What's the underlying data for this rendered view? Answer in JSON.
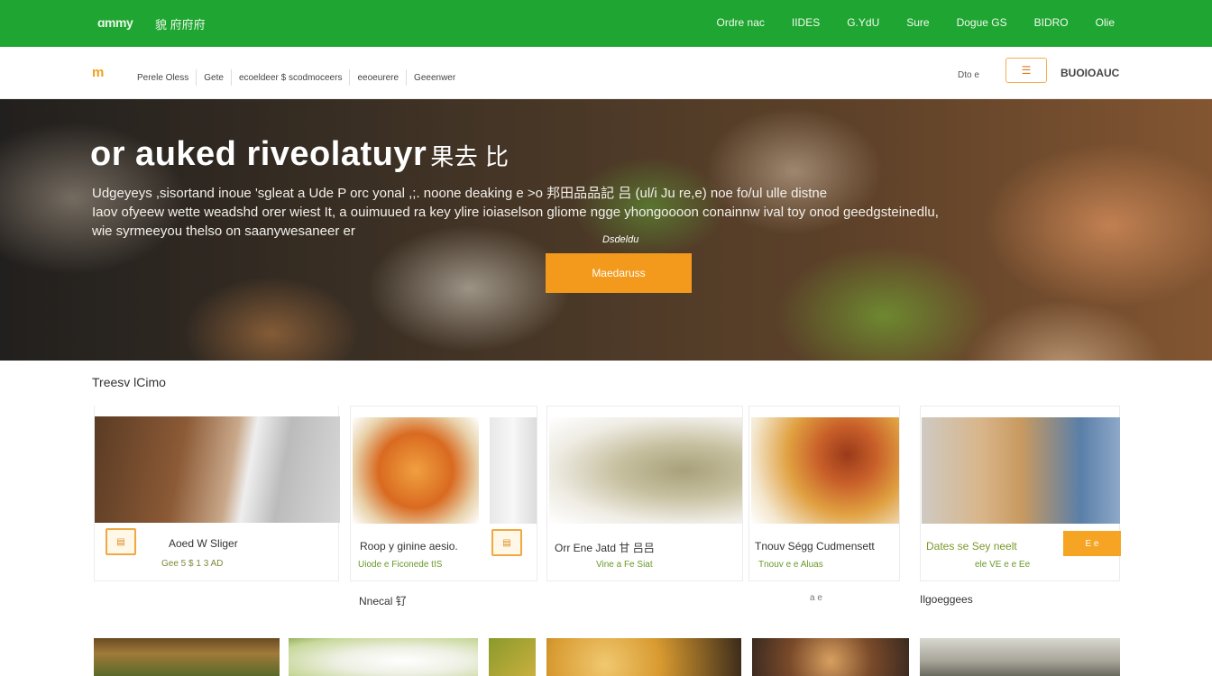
{
  "topbar": {
    "brand": "ɑmmy",
    "brand_sub": "貌 府府府",
    "nav": [
      "Ordre nac",
      "IIDES",
      "G.YdU",
      "Sure",
      "Dogue GS",
      "BIDRO",
      "Olie"
    ]
  },
  "subnav": {
    "logo": "m",
    "menu": [
      "Perele Oless",
      "Gete",
      "ecoeldeer $ scodmoceers",
      "eeoeurere",
      "Geeenwer"
    ],
    "right_label": "Dto e",
    "cart_glyph": "☰",
    "account": "BUOIOAUC"
  },
  "hero": {
    "title": "or auked riveolatuyr",
    "title_cn": "果去 比",
    "desc_lines": [
      "Udgeyeys ,sisortand inoue 'sgleat a Ude P orc yonal ,;. noone deaking e >o 邦田品品記 吕 (ul/i Ju re,e) noe fo/ul ulle distne",
      "Iaov ofyeew wette weadshd orer wiest It, a ouimuued ra key ylire ioiaselson gliome ngge yhongoooon conainnw ival toy onod geedgsteinedlu,",
      "wie syrmeeyou thelso on saanywesaneer er"
    ],
    "tag": "Dsdeldu",
    "cta": "Maedaruss"
  },
  "section": {
    "title": "Treesv lCimo"
  },
  "cards": [
    {
      "badge": "▤",
      "title": "Aoed W Sliger",
      "sub": "Gee 5 $ 1 3 AD"
    },
    {
      "badge": "▤",
      "title": "Roop y ginine aesio.",
      "sub": "Uiode e Ficonede tIS"
    },
    {
      "badge": "▤",
      "title": "Orr Ene Jatd 甘 吕吕",
      "sub": "Vine a Fe Siat"
    },
    {
      "badge": "",
      "title": "Tnouv Ségg Cudmensett",
      "sub": "Tnouv e e Aluas"
    },
    {
      "badge": "",
      "title": "Dates se Sey neelt",
      "sub": "ele VE e e Ee",
      "pill": "E e"
    }
  ],
  "under_labels": [
    "Nnecal 钌",
    "a e",
    "Ilgoeggees"
  ]
}
